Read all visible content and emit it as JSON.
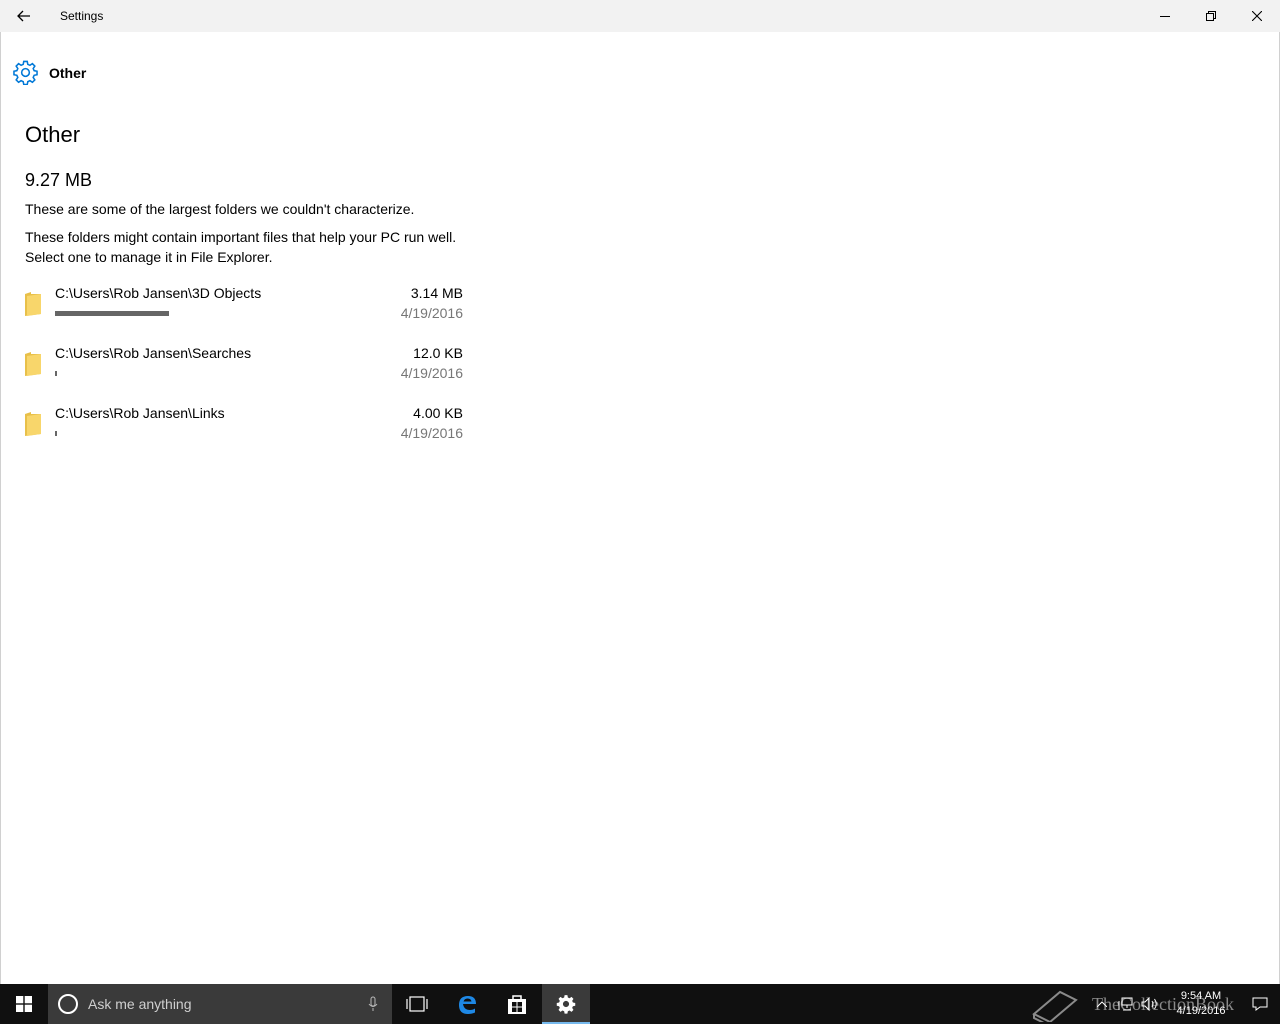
{
  "window": {
    "title": "Settings",
    "controls": [
      "minimize",
      "restore",
      "close"
    ]
  },
  "header": {
    "icon": "gear-icon",
    "label": "Other",
    "accent_color": "#0078d7"
  },
  "page": {
    "title": "Other",
    "total_size": "9.27 MB",
    "description1": "These are some of the largest folders we couldn't characterize.",
    "description2": "These folders might contain important files that help your PC run well. Select one to manage it in File Explorer."
  },
  "folders": [
    {
      "path": "C:\\Users\\Rob Jansen\\3D Objects",
      "size": "3.14 MB",
      "date": "4/19/2016",
      "usage_fraction": 0.38
    },
    {
      "path": "C:\\Users\\Rob Jansen\\Searches",
      "size": "12.0 KB",
      "date": "4/19/2016",
      "usage_fraction": 0.005
    },
    {
      "path": "C:\\Users\\Rob Jansen\\Links",
      "size": "4.00 KB",
      "date": "4/19/2016",
      "usage_fraction": 0.005
    }
  ],
  "taskbar": {
    "search_placeholder": "Ask me anything",
    "apps": [
      "task-view-icon",
      "edge-icon",
      "store-icon",
      "settings-icon"
    ],
    "active_app": "settings-icon",
    "clock_time": "9:54 AM",
    "clock_date": "4/19/2016",
    "watermark": "TheCollectionBook"
  }
}
